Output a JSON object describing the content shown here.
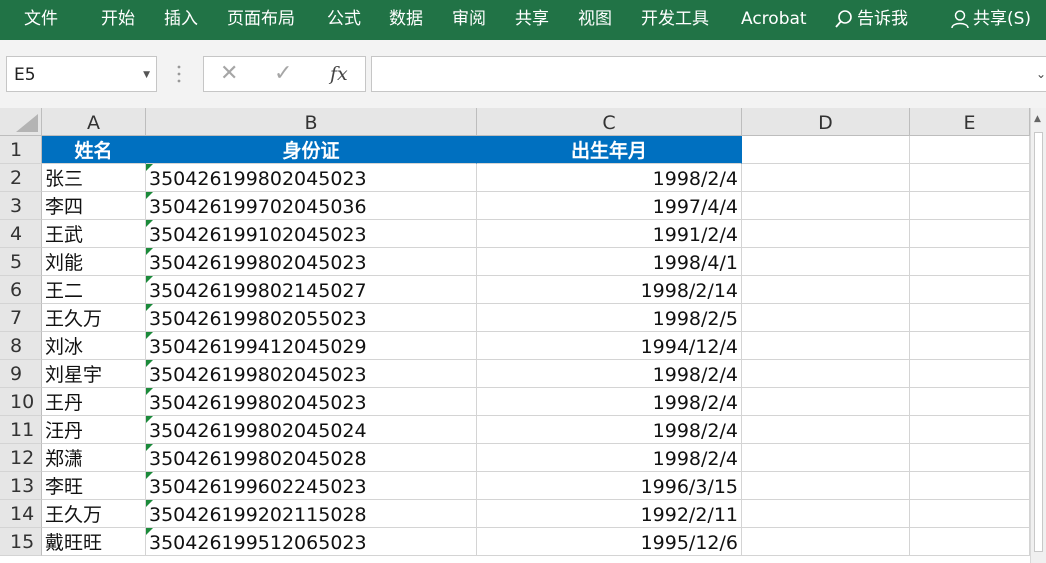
{
  "ribbon": {
    "tabs": [
      "文件",
      "开始",
      "插入",
      "页面布局",
      "公式",
      "数据",
      "审阅",
      "共享",
      "视图",
      "开发工具",
      "Acrobat"
    ],
    "tell_me": "告诉我",
    "share": "共享(S)"
  },
  "formula_bar": {
    "name_box": "E5",
    "cancel_symbol": "✕",
    "enter_symbol": "✓",
    "fx_label": "fx",
    "formula": ""
  },
  "columns": [
    "A",
    "B",
    "C",
    "D",
    "E"
  ],
  "rows": [
    "1",
    "2",
    "3",
    "4",
    "5",
    "6",
    "7",
    "8",
    "9",
    "10",
    "11",
    "12",
    "13",
    "14",
    "15"
  ],
  "table": {
    "headers": [
      "姓名",
      "身份证",
      "出生年月"
    ],
    "data": [
      [
        "张三",
        "350426199802045023",
        "1998/2/4"
      ],
      [
        "李四",
        "350426199702045036",
        "1997/4/4"
      ],
      [
        "王武",
        "350426199102045023",
        "1991/2/4"
      ],
      [
        "刘能",
        "350426199802045023",
        "1998/4/1"
      ],
      [
        "王二",
        "350426199802145027",
        "1998/2/14"
      ],
      [
        "王久万",
        "350426199802055023",
        "1998/2/5"
      ],
      [
        "刘冰",
        "350426199412045029",
        "1994/12/4"
      ],
      [
        "刘星宇",
        "350426199802045023",
        "1998/2/4"
      ],
      [
        "王丹",
        "350426199802045023",
        "1998/2/4"
      ],
      [
        "汪丹",
        "350426199802045024",
        "1998/2/4"
      ],
      [
        "郑潇",
        "350426199802045028",
        "1998/2/4"
      ],
      [
        "李旺",
        "350426199602245023",
        "1996/3/15"
      ],
      [
        "王久万",
        "350426199202115028",
        "1992/2/11"
      ],
      [
        "戴旺旺",
        "350426199512065023",
        "1995/12/6"
      ]
    ]
  }
}
